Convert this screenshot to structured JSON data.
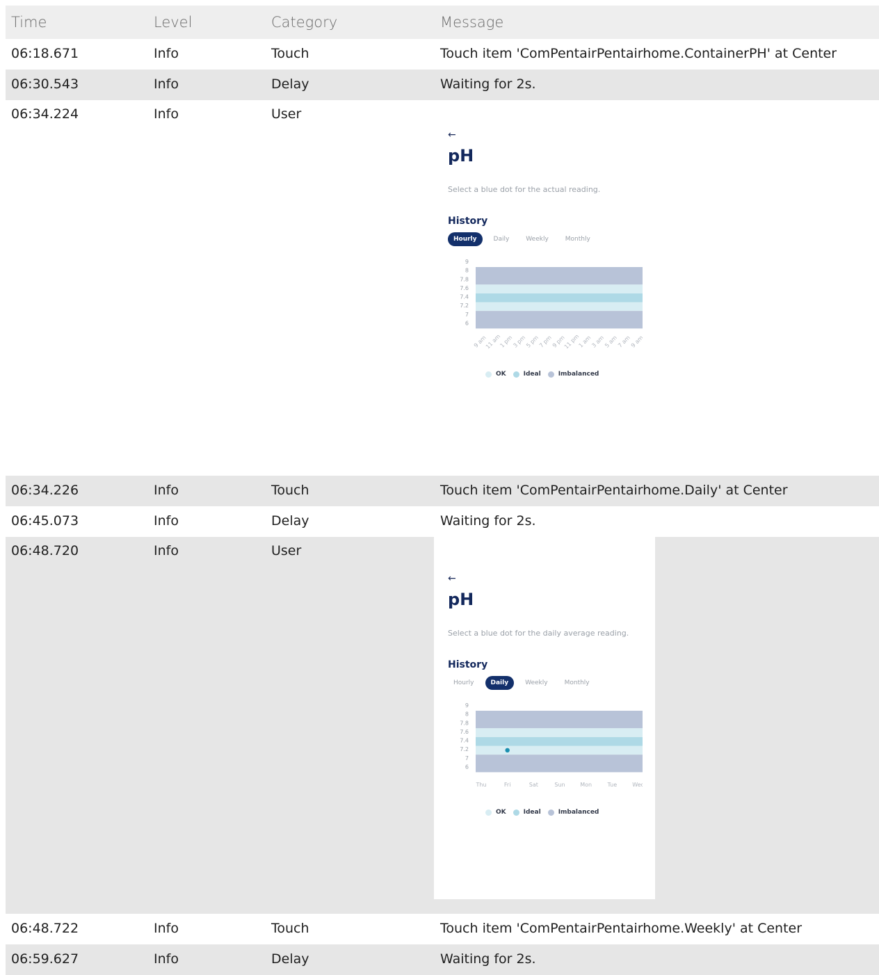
{
  "columns": {
    "time": "Time",
    "level": "Level",
    "category": "Category",
    "message": "Message"
  },
  "rows": [
    {
      "time": "06:18.671",
      "level": "Info",
      "category": "Touch",
      "message": "Touch item 'ComPentairPentairhome.ContainerPH' at Center"
    },
    {
      "time": "06:30.543",
      "level": "Info",
      "category": "Delay",
      "message": "Waiting for 2s."
    },
    {
      "time": "06:34.224",
      "level": "Info",
      "category": "User",
      "message": ""
    },
    {
      "time": "06:34.226",
      "level": "Info",
      "category": "Touch",
      "message": "Touch item 'ComPentairPentairhome.Daily' at Center"
    },
    {
      "time": "06:45.073",
      "level": "Info",
      "category": "Delay",
      "message": "Waiting for 2s."
    },
    {
      "time": "06:48.720",
      "level": "Info",
      "category": "User",
      "message": ""
    },
    {
      "time": "06:48.722",
      "level": "Info",
      "category": "Touch",
      "message": "Touch item 'ComPentairPentairhome.Weekly' at Center"
    },
    {
      "time": "06:59.627",
      "level": "Info",
      "category": "Delay",
      "message": "Waiting for 2s."
    }
  ],
  "screenshot1": {
    "back_icon": "arrow-left-icon",
    "title": "pH",
    "subtitle": "Select a blue dot for the actual reading.",
    "history": "History",
    "tabs": [
      "Hourly",
      "Daily",
      "Weekly",
      "Monthly"
    ],
    "active_tab": "Hourly",
    "legend": [
      "OK",
      "Ideal",
      "Imbalanced"
    ]
  },
  "screenshot2": {
    "back_icon": "arrow-left-icon",
    "title": "pH",
    "subtitle": "Select a blue dot for the daily average reading.",
    "history": "History",
    "tabs": [
      "Hourly",
      "Daily",
      "Weekly",
      "Monthly"
    ],
    "active_tab": "Daily",
    "legend": [
      "OK",
      "Ideal",
      "Imbalanced"
    ]
  },
  "chart_data": [
    {
      "type": "area",
      "y_ticks": [
        "9",
        "8",
        "7.8",
        "7.6",
        "7.4",
        "7.2",
        "7",
        "6"
      ],
      "x_ticks": [
        "9 am",
        "11 am",
        "1 pm",
        "3 pm",
        "5 pm",
        "7 pm",
        "9 pm",
        "11 pm",
        "1 am",
        "3 am",
        "5 am",
        "7 am",
        "9 am"
      ],
      "bands": [
        {
          "name": "Imbalanced",
          "from": "7.8",
          "to": "9"
        },
        {
          "name": "OK",
          "from": "7.6",
          "to": "7.8"
        },
        {
          "name": "Ideal",
          "from": "7.4",
          "to": "7.6"
        },
        {
          "name": "OK",
          "from": "7.2",
          "to": "7.4"
        },
        {
          "name": "Imbalanced",
          "from": "6",
          "to": "7.2"
        }
      ],
      "points": [],
      "colors": {
        "Imbalanced": "#b8c3d8",
        "OK": "#d8edf3",
        "Ideal": "#aed9e6",
        "point": "#1a8fb0"
      }
    },
    {
      "type": "scatter",
      "y_ticks": [
        "9",
        "8",
        "7.8",
        "7.6",
        "7.4",
        "7.2",
        "7",
        "6"
      ],
      "x_ticks": [
        "Thu",
        "Fri",
        "Sat",
        "Sun",
        "Mon",
        "Tue",
        "Wed"
      ],
      "bands": [
        {
          "name": "Imbalanced",
          "from": "7.8",
          "to": "9"
        },
        {
          "name": "OK",
          "from": "7.6",
          "to": "7.8"
        },
        {
          "name": "Ideal",
          "from": "7.4",
          "to": "7.6"
        },
        {
          "name": "OK",
          "from": "7.2",
          "to": "7.4"
        },
        {
          "name": "Imbalanced",
          "from": "6",
          "to": "7.2"
        }
      ],
      "points": [
        {
          "x": "Fri",
          "y": 7.3
        }
      ],
      "colors": {
        "Imbalanced": "#b8c3d8",
        "OK": "#d8edf3",
        "Ideal": "#aed9e6",
        "point": "#1a8fb0"
      }
    }
  ]
}
